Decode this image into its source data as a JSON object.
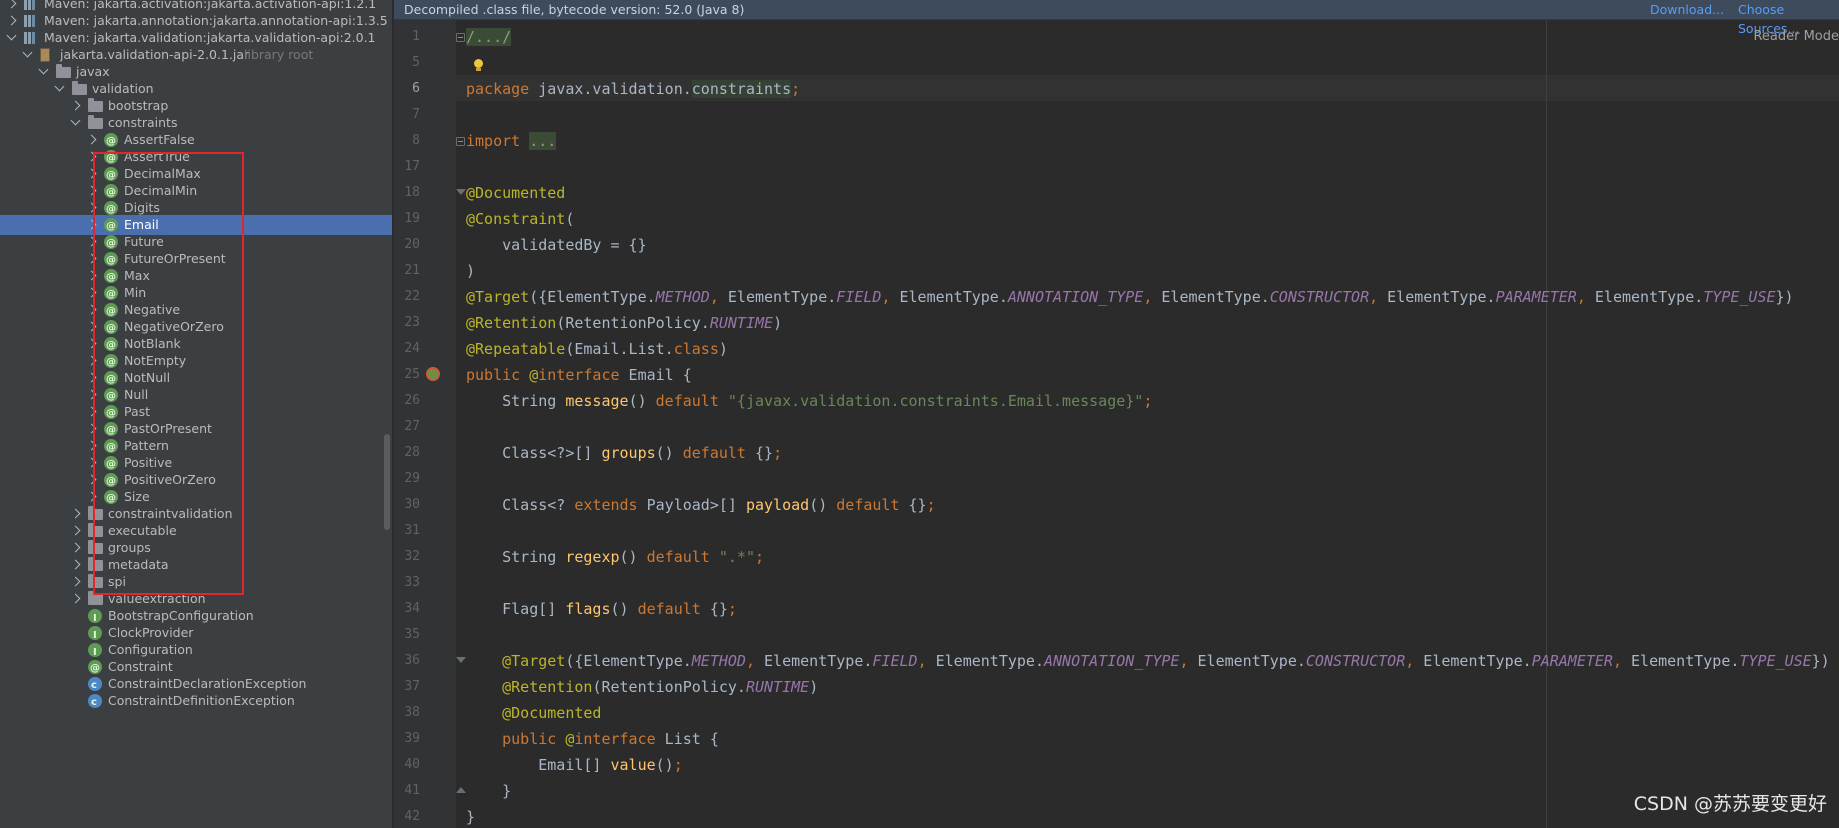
{
  "project": {
    "rows": [
      {
        "label": "Maven: jakarta.activation:jakarta.activation-api:1.2.1",
        "icon": "library-icon",
        "state": "collapsed",
        "indent": 0
      },
      {
        "label": "Maven: jakarta.annotation:jakarta.annotation-api:1.3.5",
        "icon": "library-icon",
        "state": "collapsed",
        "indent": 0
      },
      {
        "label": "Maven: jakarta.validation:jakarta.validation-api:2.0.1",
        "icon": "library-icon",
        "state": "expanded",
        "indent": 0
      },
      {
        "label": "jakarta.validation-api-2.0.1.jar",
        "suffix": "library root",
        "icon": "jar-icon",
        "state": "expanded",
        "indent": 1
      },
      {
        "label": "javax",
        "icon": "folder-icon",
        "state": "expanded",
        "indent": 2
      },
      {
        "label": "validation",
        "icon": "folder-icon",
        "state": "expanded",
        "indent": 3
      },
      {
        "label": "bootstrap",
        "icon": "folder-icon",
        "state": "collapsed",
        "indent": 4
      },
      {
        "label": "constraints",
        "icon": "folder-icon",
        "state": "expanded",
        "indent": 4
      },
      {
        "label": "AssertFalse",
        "icon": "annotation-icon",
        "state": "collapsed",
        "indent": 5
      },
      {
        "label": "AssertTrue",
        "icon": "annotation-icon",
        "state": "collapsed",
        "indent": 5
      },
      {
        "label": "DecimalMax",
        "icon": "annotation-icon",
        "state": "collapsed",
        "indent": 5
      },
      {
        "label": "DecimalMin",
        "icon": "annotation-icon",
        "state": "collapsed",
        "indent": 5
      },
      {
        "label": "Digits",
        "icon": "annotation-icon",
        "state": "collapsed",
        "indent": 5
      },
      {
        "label": "Email",
        "icon": "annotation-icon",
        "state": "collapsed",
        "indent": 5,
        "selected": true
      },
      {
        "label": "Future",
        "icon": "annotation-icon",
        "state": "collapsed",
        "indent": 5
      },
      {
        "label": "FutureOrPresent",
        "icon": "annotation-icon",
        "state": "collapsed",
        "indent": 5
      },
      {
        "label": "Max",
        "icon": "annotation-icon",
        "state": "collapsed",
        "indent": 5
      },
      {
        "label": "Min",
        "icon": "annotation-icon",
        "state": "collapsed",
        "indent": 5
      },
      {
        "label": "Negative",
        "icon": "annotation-icon",
        "state": "collapsed",
        "indent": 5
      },
      {
        "label": "NegativeOrZero",
        "icon": "annotation-icon",
        "state": "collapsed",
        "indent": 5
      },
      {
        "label": "NotBlank",
        "icon": "annotation-icon",
        "state": "collapsed",
        "indent": 5
      },
      {
        "label": "NotEmpty",
        "icon": "annotation-icon",
        "state": "collapsed",
        "indent": 5
      },
      {
        "label": "NotNull",
        "icon": "annotation-icon",
        "state": "collapsed",
        "indent": 5
      },
      {
        "label": "Null",
        "icon": "annotation-icon",
        "state": "collapsed",
        "indent": 5
      },
      {
        "label": "Past",
        "icon": "annotation-icon",
        "state": "collapsed",
        "indent": 5
      },
      {
        "label": "PastOrPresent",
        "icon": "annotation-icon",
        "state": "collapsed",
        "indent": 5
      },
      {
        "label": "Pattern",
        "icon": "annotation-icon",
        "state": "collapsed",
        "indent": 5
      },
      {
        "label": "Positive",
        "icon": "annotation-icon",
        "state": "collapsed",
        "indent": 5
      },
      {
        "label": "PositiveOrZero",
        "icon": "annotation-icon",
        "state": "collapsed",
        "indent": 5
      },
      {
        "label": "Size",
        "icon": "annotation-icon",
        "state": "collapsed",
        "indent": 5
      },
      {
        "label": "constraintvalidation",
        "icon": "folder-icon",
        "state": "collapsed",
        "indent": 4
      },
      {
        "label": "executable",
        "icon": "folder-icon",
        "state": "collapsed",
        "indent": 4
      },
      {
        "label": "groups",
        "icon": "folder-icon",
        "state": "collapsed",
        "indent": 4
      },
      {
        "label": "metadata",
        "icon": "folder-icon",
        "state": "collapsed",
        "indent": 4
      },
      {
        "label": "spi",
        "icon": "folder-icon",
        "state": "collapsed",
        "indent": 4
      },
      {
        "label": "valueextraction",
        "icon": "folder-icon",
        "state": "collapsed",
        "indent": 4
      },
      {
        "label": "BootstrapConfiguration",
        "icon": "interface-icon",
        "state": "none",
        "indent": 4
      },
      {
        "label": "ClockProvider",
        "icon": "interface-icon",
        "state": "none",
        "indent": 4
      },
      {
        "label": "Configuration",
        "icon": "interface-icon",
        "state": "none",
        "indent": 4
      },
      {
        "label": "Constraint",
        "icon": "annotation-icon",
        "state": "none",
        "indent": 4
      },
      {
        "label": "ConstraintDeclarationException",
        "icon": "class-icon",
        "state": "none",
        "indent": 4
      },
      {
        "label": "ConstraintDefinitionException",
        "icon": "class-icon",
        "state": "none",
        "indent": 4
      }
    ]
  },
  "editor": {
    "banner_text": "Decompiled .class file, bytecode version: 52.0 (Java 8)",
    "download_link": "Download...",
    "choose_sources_link": "Choose Sources...",
    "reader_mode": "Reader Mode",
    "current_line": "6",
    "lines": [
      {
        "n": "1",
        "fold": "box",
        "html": "<span class=\"fo\">/.../</span>"
      },
      {
        "n": "5",
        "fold": "",
        "html": ""
      },
      {
        "n": "6",
        "fold": "",
        "html": "<span class=\"kw\">package</span> javax.validation.<span class=\"pk\">constraints</span><span class=\"kw\">;</span>"
      },
      {
        "n": "7",
        "fold": "",
        "html": ""
      },
      {
        "n": "8",
        "fold": "box",
        "html": "<span class=\"kw\">import</span> <span class=\"fo\">...</span>"
      },
      {
        "n": "17",
        "fold": "",
        "html": ""
      },
      {
        "n": "18",
        "fold": "open",
        "html": "<span class=\"an\">@Documented</span>"
      },
      {
        "n": "19",
        "fold": "",
        "html": "<span class=\"an\">@Constraint</span>("
      },
      {
        "n": "20",
        "fold": "",
        "html": "    validatedBy = {}"
      },
      {
        "n": "21",
        "fold": "",
        "html": ")"
      },
      {
        "n": "22",
        "fold": "",
        "html": "<span class=\"an\">@Target</span>({ElementType.<span class=\"it\">METHOD</span><span class=\"kw\">,</span> ElementType.<span class=\"it\">FIELD</span><span class=\"kw\">,</span> ElementType.<span class=\"it\">ANNOTATION_TYPE</span><span class=\"kw\">,</span> ElementType.<span class=\"it\">CONSTRUCTOR</span><span class=\"kw\">,</span> ElementType.<span class=\"it\">PARAMETER</span><span class=\"kw\">,</span> ElementType.<span class=\"it\">TYPE_USE</span>})"
      },
      {
        "n": "23",
        "fold": "",
        "html": "<span class=\"an\">@Retention</span>(RetentionPolicy.<span class=\"it\">RUNTIME</span>)"
      },
      {
        "n": "24",
        "fold": "",
        "html": "<span class=\"an\">@Repeatable</span>(Email.List.<span class=\"kw\">class</span>)"
      },
      {
        "n": "25",
        "fold": "",
        "html": "<span class=\"kw\">public</span> <span class=\"an\">@</span><span class=\"kw\">interface</span> Email {"
      },
      {
        "n": "26",
        "fold": "",
        "html": "    String <span class=\"fn\">message</span>() <span class=\"kw\">default</span> <span class=\"st\">\"{javax.validation.constraints.Email.message}\"</span><span class=\"kw\">;</span>"
      },
      {
        "n": "27",
        "fold": "",
        "html": ""
      },
      {
        "n": "28",
        "fold": "",
        "html": "    Class&lt;?&gt;[] <span class=\"fn\">groups</span>() <span class=\"kw\">default</span> {}<span class=\"kw\">;</span>"
      },
      {
        "n": "29",
        "fold": "",
        "html": ""
      },
      {
        "n": "30",
        "fold": "",
        "html": "    Class&lt;? <span class=\"kw\">extends</span> Payload&gt;[] <span class=\"fn\">payload</span>() <span class=\"kw\">default</span> {}<span class=\"kw\">;</span>"
      },
      {
        "n": "31",
        "fold": "",
        "html": ""
      },
      {
        "n": "32",
        "fold": "",
        "html": "    String <span class=\"fn\">regexp</span>() <span class=\"kw\">default</span> <span class=\"st\">\".*\"</span><span class=\"kw\">;</span>"
      },
      {
        "n": "33",
        "fold": "",
        "html": ""
      },
      {
        "n": "34",
        "fold": "",
        "html": "    Flag[] <span class=\"fn\">flags</span>() <span class=\"kw\">default</span> {}<span class=\"kw\">;</span>"
      },
      {
        "n": "35",
        "fold": "",
        "html": ""
      },
      {
        "n": "36",
        "fold": "open",
        "html": "    <span class=\"an\">@Target</span>({ElementType.<span class=\"it\">METHOD</span><span class=\"kw\">,</span> ElementType.<span class=\"it\">FIELD</span><span class=\"kw\">,</span> ElementType.<span class=\"it\">ANNOTATION_TYPE</span><span class=\"kw\">,</span> ElementType.<span class=\"it\">CONSTRUCTOR</span><span class=\"kw\">,</span> ElementType.<span class=\"it\">PARAMETER</span><span class=\"kw\">,</span> ElementType.<span class=\"it\">TYPE_USE</span>})"
      },
      {
        "n": "37",
        "fold": "",
        "html": "    <span class=\"an\">@Retention</span>(RetentionPolicy.<span class=\"it\">RUNTIME</span>)"
      },
      {
        "n": "38",
        "fold": "",
        "html": "    <span class=\"an\">@Documented</span>"
      },
      {
        "n": "39",
        "fold": "",
        "html": "    <span class=\"kw\">public</span> <span class=\"an\">@</span><span class=\"kw\">interface</span> List {"
      },
      {
        "n": "40",
        "fold": "",
        "html": "        Email[] <span class=\"fn\">value</span>()<span class=\"kw\">;</span>"
      },
      {
        "n": "41",
        "fold": "close",
        "html": "    }"
      },
      {
        "n": "42",
        "fold": "",
        "html": "}"
      }
    ]
  },
  "watermark": "CSDN @苏苏要变更好",
  "colors": {
    "panel_bg": "#3c3f41",
    "editor_bg": "#2b2b2b",
    "selection": "#4b6eaf",
    "highlight_box": "#e0272c",
    "keyword": "#cc7832",
    "annotation": "#bbb529",
    "constant": "#9876aa",
    "method": "#ffc66d",
    "string": "#6a8759"
  }
}
